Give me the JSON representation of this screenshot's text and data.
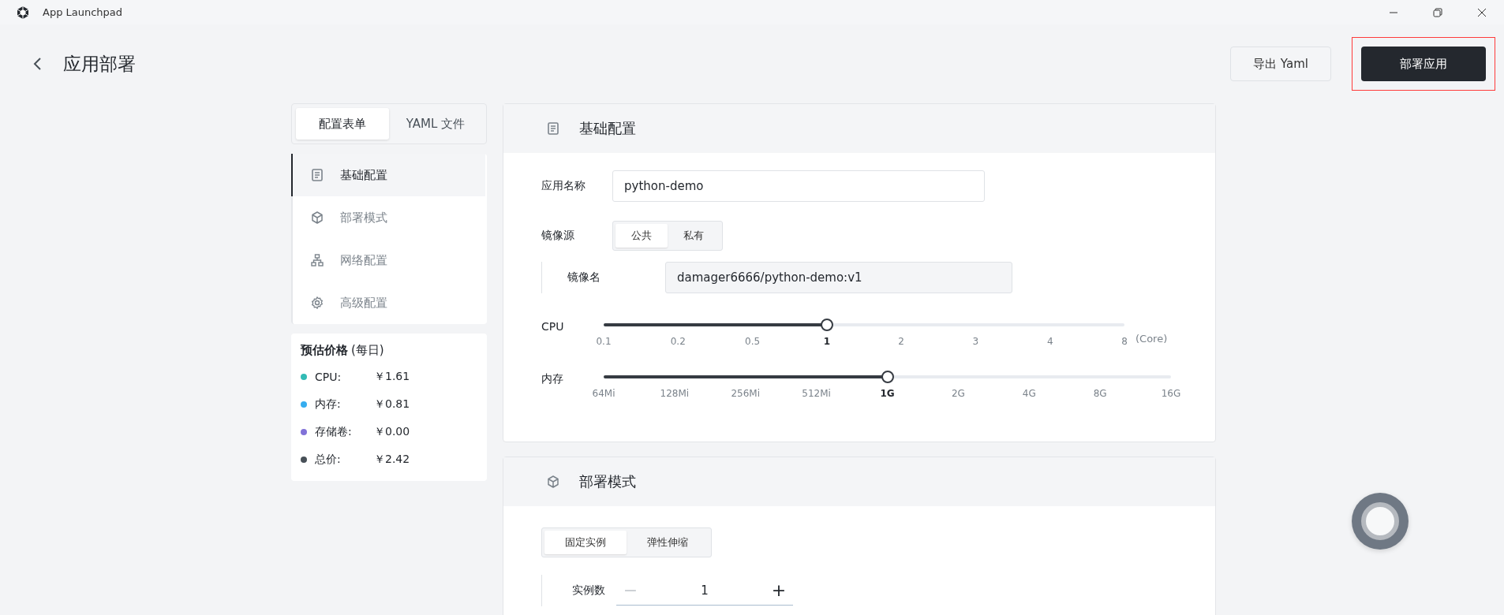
{
  "window": {
    "title": "App Launchpad"
  },
  "header": {
    "title": "应用部署",
    "buttons": [
      {
        "label": "导出 Yaml",
        "kind": "secondary",
        "highlighted": false
      },
      {
        "label": "部署应用",
        "kind": "primary",
        "highlighted": true
      }
    ]
  },
  "mode_tabs": [
    {
      "label": "配置表单",
      "selected": true
    },
    {
      "label": "YAML 文件",
      "selected": false
    }
  ],
  "nav": [
    {
      "label": "基础配置",
      "selected": true
    },
    {
      "label": "部署模式",
      "selected": false
    },
    {
      "label": "网络配置",
      "selected": false
    },
    {
      "label": "高级配置",
      "selected": false
    }
  ],
  "price": {
    "title": "预估价格",
    "period": "(每日)",
    "items": [
      {
        "label": "CPU:",
        "value": "￥1.61",
        "color": "#33bbb5"
      },
      {
        "label": "内存:",
        "value": "￥0.81",
        "color": "#36adef"
      },
      {
        "label": "存储卷:",
        "value": "￥0.00",
        "color": "#8172d8"
      },
      {
        "label": "总价:",
        "value": "￥2.42",
        "color": "#485058"
      }
    ]
  },
  "basic": {
    "title": "基础配置",
    "app_name": {
      "label": "应用名称",
      "value": "python-demo"
    },
    "image_source": {
      "label": "镜像源",
      "options": [
        {
          "label": "公共",
          "selected": true
        },
        {
          "label": "私有",
          "selected": false
        }
      ]
    },
    "image_name": {
      "label": "镜像名",
      "value": "damager6666/python-demo:v1"
    },
    "sliders": [
      {
        "label": "CPU",
        "ticks": [
          {
            "label": "0.1",
            "selected": false
          },
          {
            "label": "0.2",
            "selected": false
          },
          {
            "label": "0.5",
            "selected": false
          },
          {
            "label": "1",
            "selected": true
          },
          {
            "label": "2",
            "selected": false
          },
          {
            "label": "3",
            "selected": false
          },
          {
            "label": "4",
            "selected": false
          },
          {
            "label": "8",
            "selected": false
          }
        ],
        "level": 0.4286,
        "unit": "(Core)"
      },
      {
        "label": "内存",
        "ticks": [
          {
            "label": "64Mi",
            "selected": false
          },
          {
            "label": "128Mi",
            "selected": false
          },
          {
            "label": "256Mi",
            "selected": false
          },
          {
            "label": "512Mi",
            "selected": false
          },
          {
            "label": "1G",
            "selected": true
          },
          {
            "label": "2G",
            "selected": false
          },
          {
            "label": "4G",
            "selected": false
          },
          {
            "label": "8G",
            "selected": false
          },
          {
            "label": "16G",
            "selected": false
          }
        ],
        "level": 0.5
      }
    ]
  },
  "deploy": {
    "title": "部署模式",
    "modes": [
      {
        "label": "固定实例",
        "selected": true
      },
      {
        "label": "弹性伸缩",
        "selected": false
      }
    ],
    "replicas": {
      "label": "实例数",
      "value": "1",
      "minus": "−",
      "plus": "+",
      "minus_disabled": true
    }
  }
}
